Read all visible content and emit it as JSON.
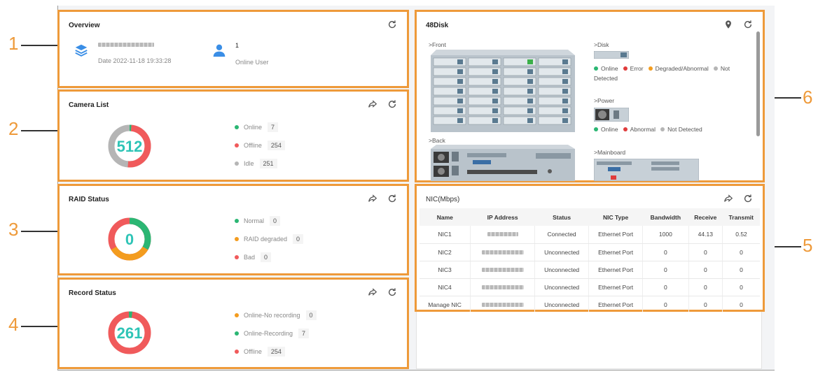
{
  "callouts": [
    "1",
    "2",
    "3",
    "4",
    "5",
    "6"
  ],
  "overview": {
    "title": "Overview",
    "date_label": "Date 2022-11-18 19:33:28",
    "online_user_count": "1",
    "online_user_label": "Online User"
  },
  "camera_list": {
    "title": "Camera List",
    "total": "512",
    "items": [
      {
        "label": "Online",
        "value": "7",
        "color": "#2bb673"
      },
      {
        "label": "Offline",
        "value": "254",
        "color": "#f05a5b"
      },
      {
        "label": "Idle",
        "value": "251",
        "color": "#b5b5b5"
      }
    ]
  },
  "raid_status": {
    "title": "RAID Status",
    "total": "0",
    "items": [
      {
        "label": "Normal",
        "value": "0",
        "color": "#2bb673"
      },
      {
        "label": "RAID degraded",
        "value": "0",
        "color": "#f39c1f"
      },
      {
        "label": "Bad",
        "value": "0",
        "color": "#f05a5b"
      }
    ]
  },
  "record_status": {
    "title": "Record Status",
    "total": "261",
    "items": [
      {
        "label": "Online-No recording",
        "value": "0",
        "color": "#f39c1f"
      },
      {
        "label": "Online-Recording",
        "value": "7",
        "color": "#2bb673"
      },
      {
        "label": "Offline",
        "value": "254",
        "color": "#f05a5b"
      }
    ]
  },
  "disk": {
    "title": "48Disk",
    "front_label": ">Front",
    "back_label": ">Back",
    "disk_label": ">Disk",
    "power_label": ">Power",
    "mainboard_label": ">Mainboard",
    "disk_legend": [
      {
        "label": "Online",
        "color": "#2bb673"
      },
      {
        "label": "Error",
        "color": "#e03c3c"
      },
      {
        "label": "Degraded/Abnormal",
        "color": "#f39c1f"
      },
      {
        "label": "Not Detected",
        "color": "#b5b5b5"
      }
    ],
    "power_legend": [
      {
        "label": "Online",
        "color": "#2bb673"
      },
      {
        "label": "Abnormal",
        "color": "#e03c3c"
      },
      {
        "label": "Not Detected",
        "color": "#b5b5b5"
      }
    ]
  },
  "nic": {
    "title": "NIC(Mbps)",
    "columns": [
      "Name",
      "IP Address",
      "Status",
      "NIC Type",
      "Bandwidth",
      "Receive",
      "Transmit"
    ],
    "rows": [
      {
        "name": "NIC1",
        "status": "Connected",
        "type": "Ethernet Port",
        "bandwidth": "1000",
        "receive": "44.13",
        "transmit": "0.52"
      },
      {
        "name": "NIC2",
        "status": "Unconnected",
        "type": "Ethernet Port",
        "bandwidth": "0",
        "receive": "0",
        "transmit": "0"
      },
      {
        "name": "NIC3",
        "status": "Unconnected",
        "type": "Ethernet Port",
        "bandwidth": "0",
        "receive": "0",
        "transmit": "0"
      },
      {
        "name": "NIC4",
        "status": "Unconnected",
        "type": "Ethernet Port",
        "bandwidth": "0",
        "receive": "0",
        "transmit": "0"
      },
      {
        "name": "Manage NIC",
        "status": "Unconnected",
        "type": "Ethernet Port",
        "bandwidth": "0",
        "receive": "0",
        "transmit": "0"
      }
    ]
  },
  "icons": {
    "refresh": "refresh-icon",
    "share": "share-icon",
    "location": "location-pin-icon",
    "storage": "layers-icon",
    "user": "user-icon"
  }
}
